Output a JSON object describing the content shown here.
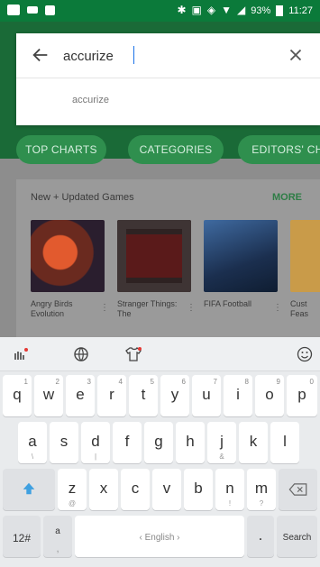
{
  "status_bar": {
    "battery": "93%",
    "time": "11:27"
  },
  "search": {
    "query": "accurize",
    "suggestion": "accurize"
  },
  "tabs": [
    {
      "label": "TOP CHARTS"
    },
    {
      "label": "CATEGORIES"
    },
    {
      "label": "EDITORS' CH"
    }
  ],
  "section": {
    "title": "New + Updated Games",
    "more": "MORE",
    "games": [
      {
        "title": "Angry Birds Evolution",
        "color": "#b8462c"
      },
      {
        "title": "Stranger Things: The",
        "color": "#3b2a2a"
      },
      {
        "title": "FIFA Football",
        "color": "#2b4e7a"
      },
      {
        "title": "Cust Feas",
        "color": "#c99b49"
      }
    ]
  },
  "keyboard": {
    "row1": [
      {
        "key": "q",
        "hint": "1"
      },
      {
        "key": "w",
        "hint": "2"
      },
      {
        "key": "e",
        "hint": "3"
      },
      {
        "key": "r",
        "hint": "4"
      },
      {
        "key": "t",
        "hint": "5"
      },
      {
        "key": "y",
        "hint": "6"
      },
      {
        "key": "u",
        "hint": "7"
      },
      {
        "key": "i",
        "hint": "8"
      },
      {
        "key": "o",
        "hint": "9"
      },
      {
        "key": "p",
        "hint": "0"
      }
    ],
    "row2": [
      {
        "key": "a",
        "sub": "\\"
      },
      {
        "key": "s",
        "sub": ""
      },
      {
        "key": "d",
        "sub": "|"
      },
      {
        "key": "f",
        "sub": ""
      },
      {
        "key": "g",
        "sub": ""
      },
      {
        "key": "h",
        "sub": ""
      },
      {
        "key": "j",
        "sub": "&"
      },
      {
        "key": "k",
        "sub": ""
      },
      {
        "key": "l",
        "sub": ""
      }
    ],
    "row3": [
      {
        "key": "z",
        "sub": "@"
      },
      {
        "key": "x",
        "sub": ""
      },
      {
        "key": "c",
        "sub": ""
      },
      {
        "key": "v",
        "sub": ""
      },
      {
        "key": "b",
        "sub": ""
      },
      {
        "key": "n",
        "sub": "!"
      },
      {
        "key": "m",
        "sub": "?"
      }
    ],
    "sym_key": "12#",
    "comma_key": "a",
    "space_label": "‹ English ›",
    "period_key": ".",
    "action_key": "Search"
  },
  "colors": {
    "status_bar": "#0b7a3a",
    "accent": "#1b73e8"
  }
}
